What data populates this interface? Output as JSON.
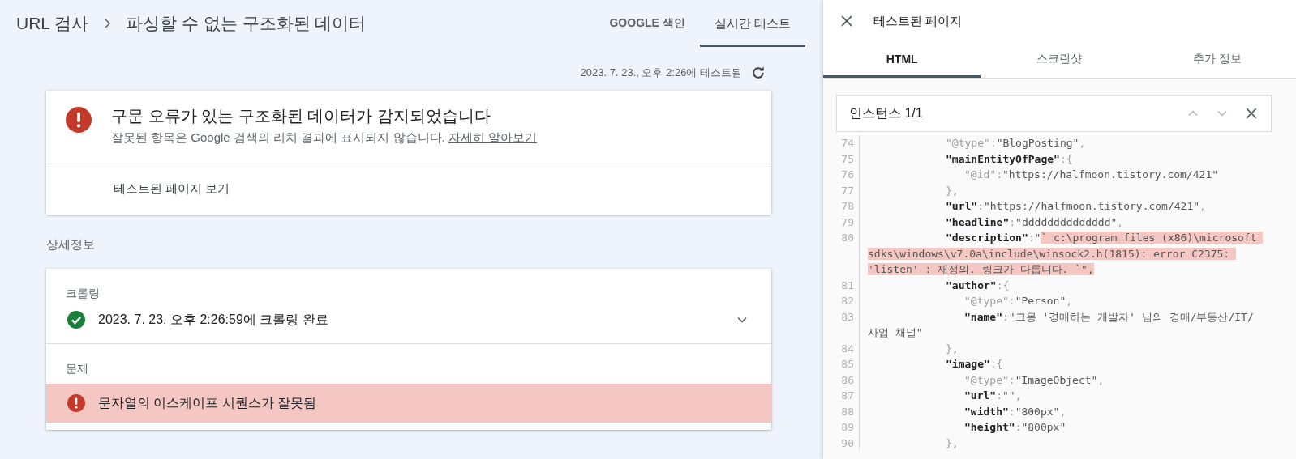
{
  "header": {
    "root": "URL 검사",
    "title": "파싱할 수 없는 구조화된 데이터"
  },
  "tabs": [
    {
      "label": "GOOGLE 색인",
      "selected": false
    },
    {
      "label": "실시간 테스트",
      "selected": true
    }
  ],
  "test_time": "2023. 7. 23., 오후 2:26에 테스트됨",
  "summary_card": {
    "kind": "error",
    "title": "구문 오류가 있는 구조화된 데이터가 감지되었습니다",
    "subtitle": "잘못된 항목은 Google 검색의 리치 결과에 표시되지 않습니다.",
    "link": "자세히 알아보기",
    "action": "테스트된 페이지 보기"
  },
  "details_heading": "상세정보",
  "crawl": {
    "label": "크롤링",
    "kind": "ok",
    "text": "2023. 7. 23. 오후 2:26:59에 크롤링 완료",
    "expanded": false
  },
  "issues": {
    "label": "문제",
    "items": [
      {
        "kind": "error",
        "text": "문자열의 이스케이프 시퀀스가 잘못됨"
      }
    ]
  },
  "panel": {
    "title": "테스트된 페이지",
    "tabs": [
      {
        "label": "HTML",
        "selected": true
      },
      {
        "label": "스크린샷",
        "selected": false
      },
      {
        "label": "추가 정보",
        "selected": false
      }
    ],
    "search": {
      "text": "인스턴스 1/1"
    },
    "code": [
      {
        "number": "74",
        "tokens": [
          {
            "kind": "meta",
            "text": "\"@type\""
          },
          {
            "kind": "punct",
            "text": ":"
          },
          {
            "kind": "value",
            "text": "\"BlogPosting\""
          },
          {
            "kind": "punct",
            "text": ","
          }
        ]
      },
      {
        "number": "75",
        "tokens": [
          {
            "kind": "key",
            "text": "\"mainEntityOfPage\""
          },
          {
            "kind": "punct",
            "text": ":{"
          }
        ],
        "children": [
          {
            "number": "76",
            "tokens": [
              {
                "kind": "meta",
                "text": "\"@id\""
              },
              {
                "kind": "punct",
                "text": ":"
              },
              {
                "kind": "value",
                "text": "\"https://halfmoon.tistory.com/421\""
              }
            ]
          }
        ]
      },
      {
        "number": "77",
        "tokens": [
          {
            "kind": "punct",
            "text": "},"
          }
        ]
      },
      {
        "number": "78",
        "tokens": [
          {
            "kind": "key",
            "text": "\"url\""
          },
          {
            "kind": "punct",
            "text": ":"
          },
          {
            "kind": "value",
            "text": "\"https://halfmoon.tistory.com/421\""
          },
          {
            "kind": "punct",
            "text": ","
          }
        ]
      },
      {
        "number": "79",
        "tokens": [
          {
            "kind": "key",
            "text": "\"headline\""
          },
          {
            "kind": "punct",
            "text": ":"
          },
          {
            "kind": "value",
            "text": "\"dddddddddddddd\""
          },
          {
            "kind": "punct",
            "text": ","
          }
        ]
      },
      {
        "number": "80",
        "tokens": [
          {
            "kind": "key",
            "text": "\"description\""
          },
          {
            "kind": "punct",
            "text": ":"
          },
          {
            "kind": "value",
            "text": "\""
          },
          {
            "kind": "value",
            "highlighted": true,
            "text": "` c:\\program files (x86)\\microsoft sdks\\windows\\v7.0a\\include\\winsock2.h(1815): error C2375: 'listen' : 재정의. 링크가 다릅니다. `\","
          }
        ]
      },
      {
        "number": "81",
        "tokens": [
          {
            "kind": "key",
            "text": "\"author\""
          },
          {
            "kind": "punct",
            "text": ":{"
          }
        ],
        "children": [
          {
            "number": "82",
            "tokens": [
              {
                "kind": "meta",
                "text": "\"@type\""
              },
              {
                "kind": "punct",
                "text": ":"
              },
              {
                "kind": "value",
                "text": "\"Person\""
              },
              {
                "kind": "punct",
                "text": ","
              }
            ]
          },
          {
            "number": "83",
            "tokens": [
              {
                "kind": "key",
                "text": "\"name\""
              },
              {
                "kind": "punct",
                "text": ":"
              },
              {
                "kind": "value",
                "text": "\"크몽 '경매하는 개발자' 님의 경매/부동산/IT/사업 채널\""
              }
            ]
          }
        ]
      },
      {
        "number": "84",
        "tokens": [
          {
            "kind": "punct",
            "text": "},"
          }
        ]
      },
      {
        "number": "85",
        "tokens": [
          {
            "kind": "key",
            "text": "\"image\""
          },
          {
            "kind": "punct",
            "text": ":{"
          }
        ],
        "children": [
          {
            "number": "86",
            "tokens": [
              {
                "kind": "meta",
                "text": "\"@type\""
              },
              {
                "kind": "punct",
                "text": ":"
              },
              {
                "kind": "value",
                "text": "\"ImageObject\""
              },
              {
                "kind": "punct",
                "text": ","
              }
            ]
          },
          {
            "number": "87",
            "tokens": [
              {
                "kind": "key",
                "text": "\"url\""
              },
              {
                "kind": "punct",
                "text": ":"
              },
              {
                "kind": "value",
                "text": "\"\""
              },
              {
                "kind": "punct",
                "text": ","
              }
            ]
          },
          {
            "number": "88",
            "tokens": [
              {
                "kind": "key",
                "text": "\"width\""
              },
              {
                "kind": "punct",
                "text": ":"
              },
              {
                "kind": "value",
                "text": "\"800px\""
              },
              {
                "kind": "punct",
                "text": ","
              }
            ]
          },
          {
            "number": "89",
            "tokens": [
              {
                "kind": "key",
                "text": "\"height\""
              },
              {
                "kind": "punct",
                "text": ":"
              },
              {
                "kind": "value",
                "text": "\"800px\""
              }
            ]
          }
        ]
      },
      {
        "number": "90",
        "tokens": [
          {
            "kind": "punct",
            "text": "},"
          }
        ]
      }
    ]
  }
}
